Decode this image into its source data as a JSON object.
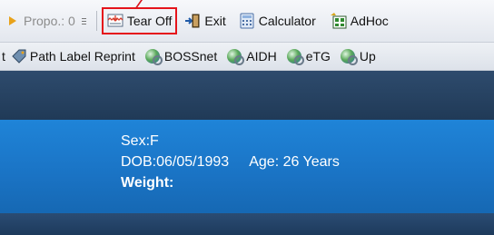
{
  "toolbar1": {
    "propo": "Propo.: 0",
    "tear_off": "Tear Off",
    "exit": "Exit",
    "calculator": "Calculator",
    "adhoc": "AdHoc"
  },
  "toolbar2": {
    "reprint_prefix": "t",
    "path_label_reprint": "Path Label Reprint",
    "bossnet": "BOSSnet",
    "aidh": "AIDH",
    "etg": "eTG",
    "up": "Up"
  },
  "patient": {
    "sex": "Sex:F",
    "dob": "DOB:06/05/1993",
    "age": "Age: 26 Years",
    "weight_label": "Weight:"
  },
  "colors": {
    "highlight": "#e5141b",
    "banner_blue": "#1a73c4",
    "dark_band": "#203a57"
  }
}
